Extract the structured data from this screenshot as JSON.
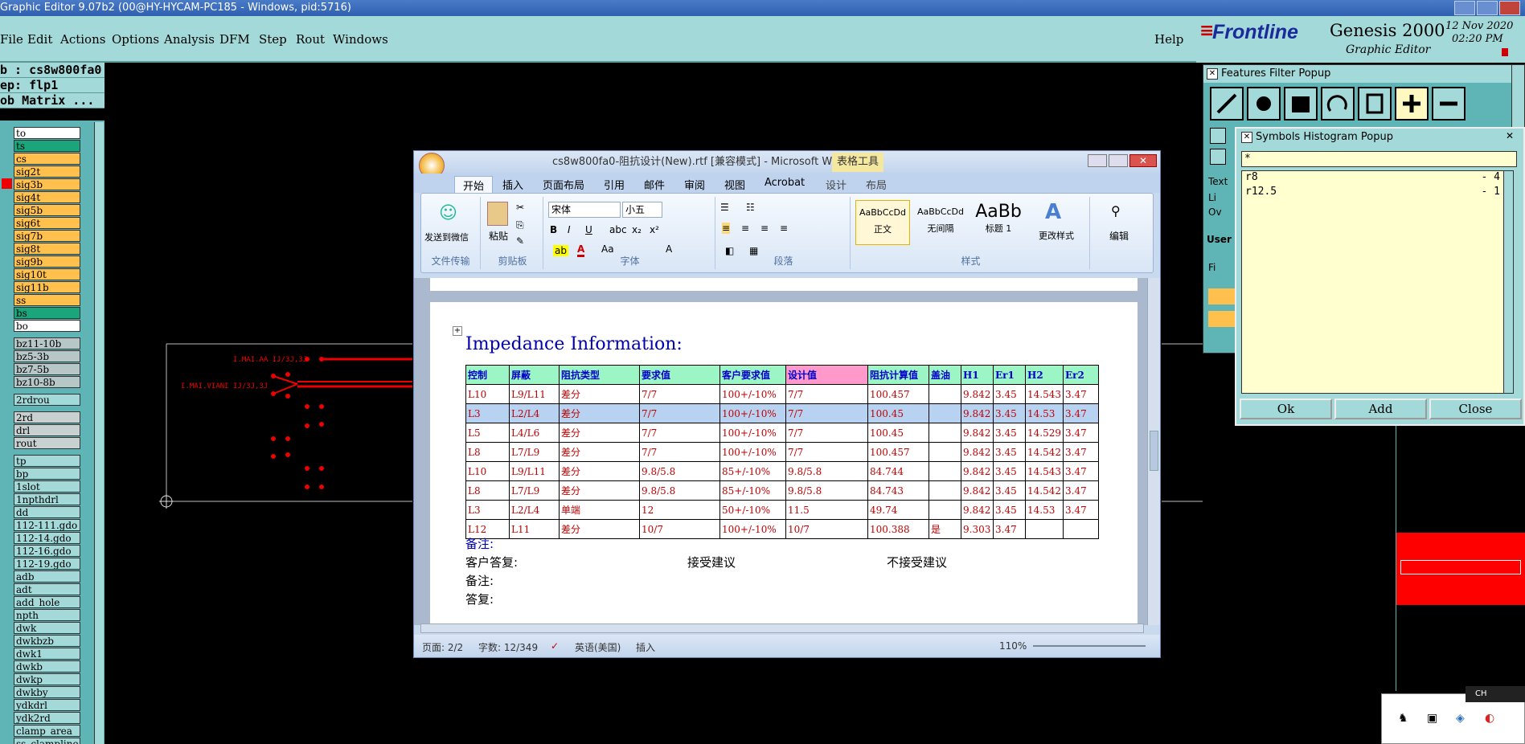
{
  "app": {
    "title": "Graphic Editor 9.07b2 (00@HY-HYCAM-PC185 - Windows, pid:5716)",
    "menu": [
      "File",
      "Edit",
      "Actions",
      "Options",
      "Analysis",
      "DFM",
      "Step",
      "Rout",
      "Windows"
    ],
    "help": "Help",
    "brand": {
      "logo": "Frontline",
      "product": "Genesis 2000",
      "sub": "Graphic Editor",
      "date": "12 Nov 2020",
      "time": "02:20 PM"
    },
    "job": "b : cs8w800fa0",
    "step": "ep: flp1",
    "matrix": "ob Matrix ...",
    "layers": [
      {
        "name": "to",
        "color": "#ffffff"
      },
      {
        "name": "ts",
        "color": "#1aa57a"
      },
      {
        "name": "cs",
        "color": "#ffc04d"
      },
      {
        "name": "sig2t",
        "color": "#ffc04d"
      },
      {
        "name": "sig3b",
        "color": "#ffc04d"
      },
      {
        "name": "sig4t",
        "color": "#ffc04d"
      },
      {
        "name": "sig5b",
        "color": "#ffc04d"
      },
      {
        "name": "sig6t",
        "color": "#ffc04d"
      },
      {
        "name": "sig7b",
        "color": "#ffc04d"
      },
      {
        "name": "sig8t",
        "color": "#ffc04d"
      },
      {
        "name": "sig9b",
        "color": "#ffc04d"
      },
      {
        "name": "sig10t",
        "color": "#ffc04d"
      },
      {
        "name": "sig11b",
        "color": "#ffc04d"
      },
      {
        "name": "ss",
        "color": "#ffc04d"
      },
      {
        "name": "bs",
        "color": "#1aa57a"
      },
      {
        "name": "bo",
        "color": "#ffffff"
      }
    ],
    "layers2": [
      "bz11-10b",
      "bz5-3b",
      "bz7-5b",
      "bz10-8b"
    ],
    "layers3": [
      "2rdrou"
    ],
    "layers4": [
      "2rd",
      "drl",
      "rout"
    ],
    "layers5": [
      "tp",
      "bp",
      "1slot",
      "1npthdrl",
      "dd",
      "112-111.gdo",
      "112-14.gdo",
      "112-16.gdo",
      "112-19.gdo",
      "adb",
      "adt",
      "add_hole",
      "npth",
      "dwk",
      "dwkbzb",
      "dwk1",
      "dwkb",
      "dwkp",
      "dwkby",
      "ydkdrl",
      "ydk2rd",
      "clamp_area",
      "ss_clampline"
    ]
  },
  "word": {
    "title": "cs8w800fa0-阻抗设计(New).rtf [兼容模式] - Microsoft Word",
    "context_tab": "表格工具",
    "tabs": [
      "开始",
      "插入",
      "页面布局",
      "引用",
      "邮件",
      "审阅",
      "视图",
      "Acrobat",
      "设计",
      "布局"
    ],
    "groups": [
      "文件传输",
      "剪贴板",
      "字体",
      "段落",
      "样式"
    ],
    "send": "发送到微信",
    "paste": "粘贴",
    "font": "宋体",
    "size": "小五",
    "styles": [
      {
        "sample": "AaBbCcDd",
        "name": "正文"
      },
      {
        "sample": "AaBbCcDd",
        "name": "无间隔"
      },
      {
        "sample": "AaBb",
        "name": "标题 1"
      }
    ],
    "change_style": "更改样式",
    "edit": "编辑",
    "heading": "Impedance Information:",
    "headers": [
      "控制",
      "屏蔽",
      "阻抗类型",
      "要求值",
      "客户要求值",
      "设计值",
      "阻抗计算值",
      "盖油",
      "H1",
      "Er1",
      "H2",
      "Er2"
    ],
    "rows": [
      [
        "L10",
        "L9/L11",
        "差分",
        "7/7",
        "100+/-10%",
        "7/7",
        "100.457",
        "",
        "9.842",
        "3.45",
        "14.543",
        "3.47"
      ],
      [
        "L3",
        "L2/L4",
        "差分",
        "7/7",
        "100+/-10%",
        "7/7",
        "100.45",
        "",
        "9.842",
        "3.45",
        "14.53",
        "3.47"
      ],
      [
        "L5",
        "L4/L6",
        "差分",
        "7/7",
        "100+/-10%",
        "7/7",
        "100.45",
        "",
        "9.842",
        "3.45",
        "14.529",
        "3.47"
      ],
      [
        "L8",
        "L7/L9",
        "差分",
        "7/7",
        "100+/-10%",
        "7/7",
        "100.457",
        "",
        "9.842",
        "3.45",
        "14.542",
        "3.47"
      ],
      [
        "L10",
        "L9/L11",
        "差分",
        "9.8/5.8",
        "85+/-10%",
        "9.8/5.8",
        "84.744",
        "",
        "9.842",
        "3.45",
        "14.543",
        "3.47"
      ],
      [
        "L8",
        "L7/L9",
        "差分",
        "9.8/5.8",
        "85+/-10%",
        "9.8/5.8",
        "84.743",
        "",
        "9.842",
        "3.45",
        "14.542",
        "3.47"
      ],
      [
        "L3",
        "L2/L4",
        "单端",
        "12",
        "50+/-10%",
        "11.5",
        "49.74",
        "",
        "9.842",
        "3.45",
        "14.53",
        "3.47"
      ],
      [
        "L12",
        "L11",
        "差分",
        "10/7",
        "100+/-10%",
        "10/7",
        "100.388",
        "是",
        "9.303",
        "3.47",
        "",
        ""
      ]
    ],
    "note1": "备注:",
    "reply_label": "客户答复:",
    "accept": "接受建议",
    "reject": "不接受建议",
    "note2": "备注:",
    "reply2": "答复:",
    "status": {
      "page": "页面: 2/2",
      "words": "字数: 12/349",
      "lang": "英语(美国)",
      "mode": "插入",
      "zoom": "110%"
    }
  },
  "features_popup": {
    "title": "Features Filter Popup",
    "labels": [
      "Text",
      "Li",
      "Ov",
      "User",
      "Fi"
    ]
  },
  "histogram": {
    "title": "Symbols Histogram Popup",
    "filter": "*",
    "items": [
      {
        "name": "r8",
        "count": "- 4"
      },
      {
        "name": "r12.5",
        "count": "- 1"
      }
    ],
    "buttons": [
      "Ok",
      "Add",
      "Close"
    ]
  },
  "tray": {
    "lang": "CH"
  }
}
